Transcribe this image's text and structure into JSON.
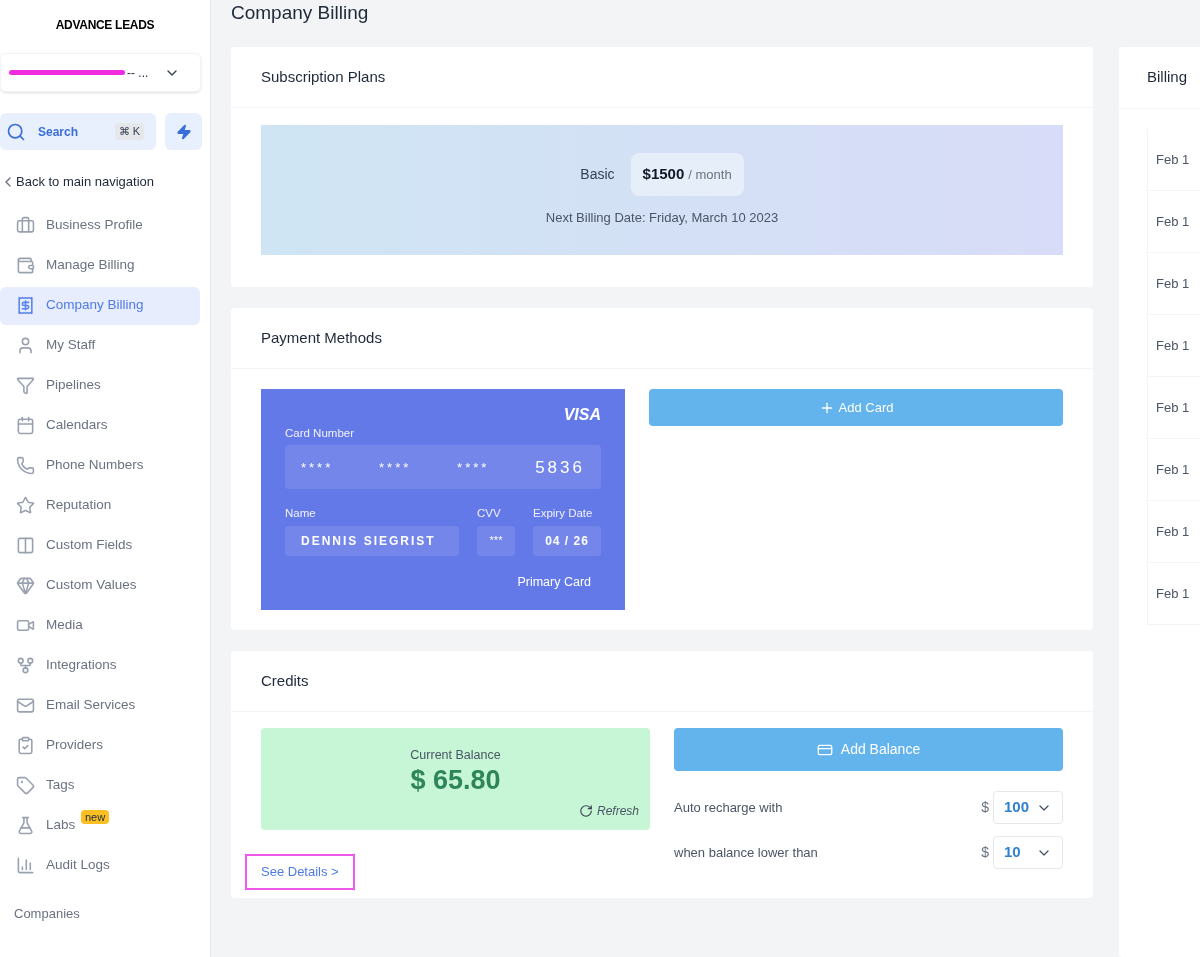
{
  "sidebar": {
    "logo": "ADVANCE LEADS",
    "account": {
      "label": "-- ...",
      "redacted": true
    },
    "search": {
      "label": "Search",
      "shortcut": "⌘ K"
    },
    "back": "Back to main navigation",
    "items": [
      {
        "label": "Business Profile",
        "selected": false
      },
      {
        "label": "Manage Billing",
        "selected": false
      },
      {
        "label": "Company Billing",
        "selected": true
      },
      {
        "label": "My Staff",
        "selected": false
      },
      {
        "label": "Pipelines",
        "selected": false
      },
      {
        "label": "Calendars",
        "selected": false
      },
      {
        "label": "Phone Numbers",
        "selected": false
      },
      {
        "label": "Reputation",
        "selected": false
      },
      {
        "label": "Custom Fields",
        "selected": false
      },
      {
        "label": "Custom Values",
        "selected": false
      },
      {
        "label": "Media",
        "selected": false
      },
      {
        "label": "Integrations",
        "selected": false
      },
      {
        "label": "Email Services",
        "selected": false
      },
      {
        "label": "Providers",
        "selected": false
      },
      {
        "label": "Tags",
        "selected": false
      },
      {
        "label": "Labs",
        "selected": false,
        "badge": "new"
      },
      {
        "label": "Audit Logs",
        "selected": false
      }
    ],
    "section": "Companies"
  },
  "page_title": "Company Billing",
  "subscription": {
    "title": "Subscription Plans",
    "plan": "Basic",
    "price": "$1500",
    "period": "/ month",
    "next_billing": "Next Billing Date: Friday, March 10 2023"
  },
  "payment": {
    "title": "Payment Methods",
    "card": {
      "brand": "VISA",
      "number_label": "Card Number",
      "groups": [
        "****",
        "****",
        "****",
        "5836"
      ],
      "name_label": "Name",
      "name": "DENNIS SIEGRIST",
      "cvv_label": "CVV",
      "cvv": "***",
      "expiry_label": "Expiry Date",
      "expiry": "04 / 26",
      "note": "Primary Card"
    },
    "add_button": "Add Card"
  },
  "credits": {
    "title": "Credits",
    "balance_label": "Current Balance",
    "balance": "$ 65.80",
    "refresh": "Refresh",
    "add_button": "Add Balance",
    "details_link": "See Details >",
    "details_highlighted": true,
    "settings": [
      {
        "label": "Auto recharge with",
        "currency": "$",
        "value": "100"
      },
      {
        "label": "when balance lower than",
        "currency": "$",
        "value": "10"
      }
    ]
  },
  "billing_panel": {
    "title": "Billing",
    "rows": [
      "Feb 1",
      "Feb 1",
      "Feb 1",
      "Feb 1",
      "Feb 1",
      "Feb 1",
      "Feb 1",
      "Feb 1"
    ]
  }
}
